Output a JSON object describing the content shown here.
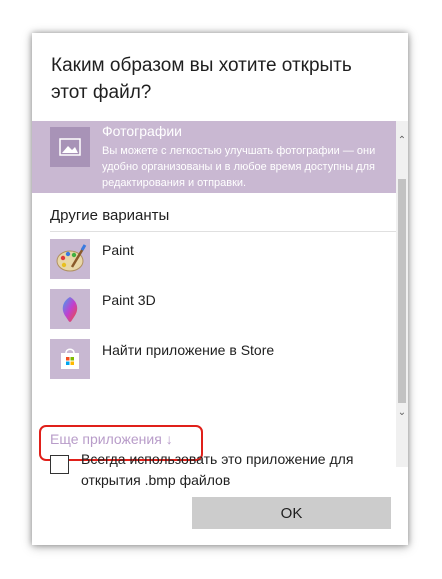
{
  "dialog": {
    "title": "Каким образом вы хотите открыть\nэтот файл?"
  },
  "featured_app": {
    "name": "Фотографии",
    "description": "Вы можете с легкостью улучшать фотографии — они удобно организованы и в любое время доступны для редактирования и отправки.",
    "icon": "photos-icon"
  },
  "other_options": {
    "label": "Другие варианты",
    "items": [
      {
        "label": "Paint",
        "icon": "paint-palette-icon"
      },
      {
        "label": "Paint 3D",
        "icon": "paint-3d-icon"
      },
      {
        "label": "Найти приложение в Store",
        "icon": "store-bag-icon"
      }
    ],
    "more_apps_label": "Еще приложения ↓"
  },
  "always_use": {
    "label": "Всегда использовать это приложение для открытия .bmp файлов",
    "checked": false
  },
  "ok_button": {
    "label": "OK"
  },
  "colors": {
    "featured_bg": "#c9b8d2",
    "tile_bg": "#c8b8d2",
    "more_link": "#b89cc9",
    "highlight_border": "#e0201a",
    "button_bg": "#cccccc"
  }
}
